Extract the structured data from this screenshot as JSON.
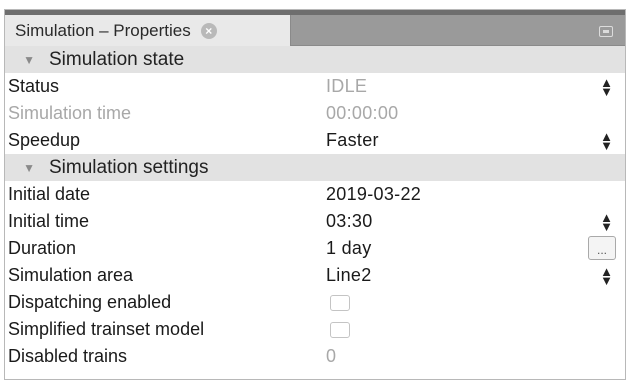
{
  "tab": {
    "title": "Simulation – Properties"
  },
  "sections": {
    "state": {
      "title": "Simulation state"
    },
    "settings": {
      "title": "Simulation settings"
    }
  },
  "state_rows": {
    "status": {
      "label": "Status",
      "value": "IDLE"
    },
    "sim_time": {
      "label": "Simulation time",
      "value": "00:00:00"
    },
    "speedup": {
      "label": "Speedup",
      "value": "Faster"
    }
  },
  "settings_rows": {
    "initial_date": {
      "label": "Initial date",
      "value": "2019-03-22"
    },
    "initial_time": {
      "label": "Initial time",
      "value": "03:30"
    },
    "duration": {
      "label": "Duration",
      "value": "1 day",
      "button": "..."
    },
    "area": {
      "label": "Simulation area",
      "value": "Line2"
    },
    "dispatching": {
      "label": "Dispatching enabled",
      "checked": false
    },
    "simplified": {
      "label": "Simplified trainset model",
      "checked": false
    },
    "disabled_trains": {
      "label": "Disabled trains",
      "value": "0"
    }
  }
}
